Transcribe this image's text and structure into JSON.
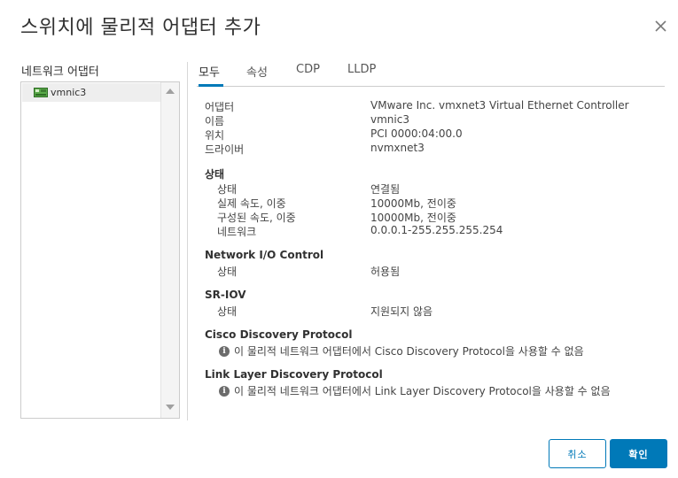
{
  "dialog": {
    "title": "스위치에 물리적 어댑터 추가"
  },
  "left": {
    "label": "네트워크 어댑터",
    "adapters": [
      {
        "name": "vmnic3"
      }
    ]
  },
  "tabs": [
    {
      "label": "모두",
      "active": true
    },
    {
      "label": "속성",
      "active": false
    },
    {
      "label": "CDP",
      "active": false
    },
    {
      "label": "LLDP",
      "active": false
    }
  ],
  "details": {
    "general": [
      {
        "key": "어댑터",
        "value": "VMware Inc. vmxnet3 Virtual Ethernet Controller"
      },
      {
        "key": "이름",
        "value": "vmnic3"
      },
      {
        "key": "위치",
        "value": "PCI 0000:04:00.0"
      },
      {
        "key": "드라이버",
        "value": "nvmxnet3"
      }
    ],
    "status": {
      "title": "상태",
      "rows": [
        {
          "key": "상태",
          "value": "연결됨"
        },
        {
          "key": "실제 속도, 이중",
          "value": "10000Mb, 전이중"
        },
        {
          "key": "구성된 속도, 이중",
          "value": "10000Mb, 전이중"
        },
        {
          "key": "네트워크",
          "value": "0.0.0.1-255.255.255.254"
        }
      ]
    },
    "network_io": {
      "title": "Network I/O Control",
      "rows": [
        {
          "key": "상태",
          "value": "허용됨"
        }
      ]
    },
    "sriov": {
      "title": "SR-IOV",
      "rows": [
        {
          "key": "상태",
          "value": "지원되지 않음"
        }
      ]
    },
    "cdp": {
      "title": "Cisco Discovery Protocol",
      "message": "이 물리적 네트워크 어댑터에서 Cisco Discovery Protocol을 사용할 수 없음"
    },
    "lldp": {
      "title": "Link Layer Discovery Protocol",
      "message": "이 물리적 네트워크 어댑터에서 Link Layer Discovery Protocol을 사용할 수 없음"
    }
  },
  "buttons": {
    "cancel": "취소",
    "ok": "확인"
  },
  "colors": {
    "accent": "#0079b8",
    "nic_icon": "#4a9a3a"
  }
}
